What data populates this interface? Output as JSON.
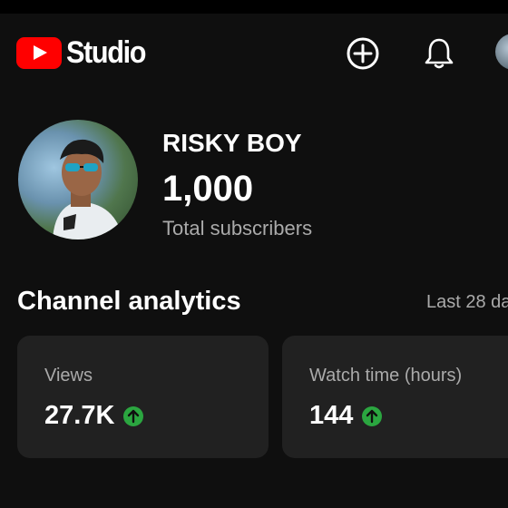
{
  "app": {
    "logo_text": "Studio"
  },
  "header": {
    "create_icon": "add-circle-icon",
    "notifications_icon": "bell-icon"
  },
  "channel": {
    "name": "RISKY BOY",
    "subscriber_count": "1,000",
    "subscriber_label": "Total subscribers"
  },
  "analytics": {
    "title": "Channel analytics",
    "period": "Last 28 da",
    "cards": [
      {
        "label": "Views",
        "value": "27.7K",
        "trend": "up"
      },
      {
        "label": "Watch time (hours)",
        "value": "144",
        "trend": "up"
      }
    ]
  },
  "colors": {
    "background": "#0f0f0f",
    "card": "#212121",
    "brand_red": "#ff0000",
    "trend_up": "#2ba640",
    "muted_text": "#aaaaaa"
  }
}
